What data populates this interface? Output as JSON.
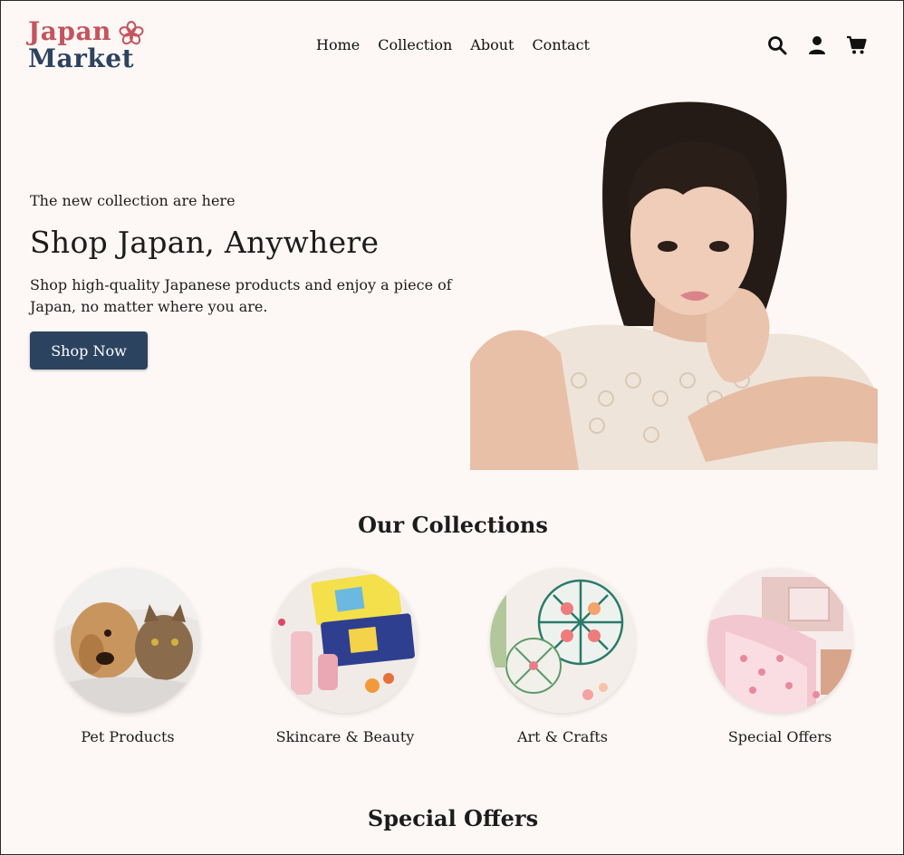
{
  "logo": {
    "line1": "Japan",
    "line2": "Market"
  },
  "nav": {
    "items": [
      "Home",
      "Collection",
      "About",
      "Contact"
    ]
  },
  "header_icons": [
    "search-icon",
    "user-icon",
    "cart-icon"
  ],
  "hero": {
    "subtitle": "The new collection are here",
    "title": "Shop Japan, Anywhere",
    "description": "Shop high-quality Japanese products and enjoy a piece of Japan, no matter where you are.",
    "button": "Shop Now"
  },
  "collections": {
    "title": "Our Collections",
    "items": [
      {
        "label": "Pet Products"
      },
      {
        "label": "Skincare & Beauty"
      },
      {
        "label": "Art & Crafts"
      },
      {
        "label": "Special Offers"
      }
    ]
  },
  "special_offers": {
    "title": "Special Offers"
  },
  "colors": {
    "brand_red": "#c4545e",
    "brand_navy": "#2c4360",
    "background": "#fdf8f5"
  }
}
